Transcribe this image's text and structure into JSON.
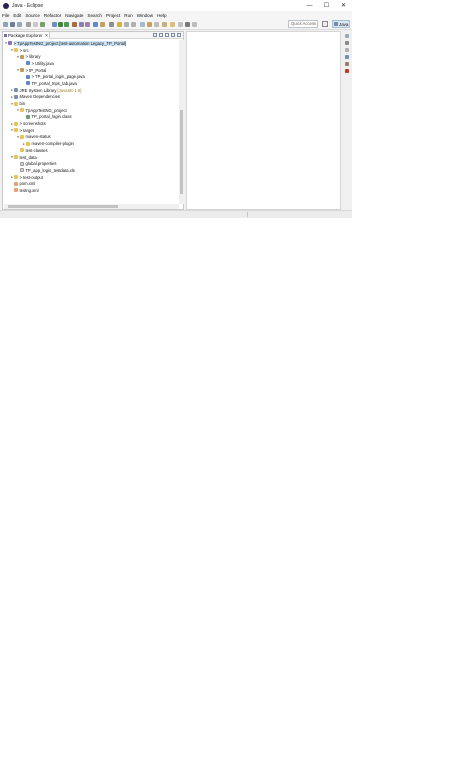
{
  "window": {
    "title": "Java - Eclipse",
    "controls": [
      "—",
      "☐",
      "✕"
    ]
  },
  "menu": [
    "File",
    "Edit",
    "Source",
    "Refactor",
    "Navigate",
    "Search",
    "Project",
    "Run",
    "Window",
    "Help"
  ],
  "toolbar": {
    "quick_access_placeholder": "Quick Access",
    "perspective_label": "Java"
  },
  "explorer": {
    "tab_label": "Package Explorer",
    "tab_close": "✕",
    "tree": [
      {
        "depth": 0,
        "expanded": true,
        "icon": "project",
        "label": "> TpAppTestNG_project [test-automation Legacy_TP_Portal]",
        "selected": true
      },
      {
        "depth": 1,
        "expanded": true,
        "icon": "folder",
        "label": "> src"
      },
      {
        "depth": 2,
        "expanded": true,
        "icon": "pkg",
        "label": "> library"
      },
      {
        "depth": 3,
        "expanded": null,
        "icon": "java",
        "label": "> Utility.java"
      },
      {
        "depth": 2,
        "expanded": true,
        "icon": "pkg",
        "label": "> tP_Portal"
      },
      {
        "depth": 3,
        "expanded": null,
        "icon": "java",
        "label": "> TP_portal_login_page.java"
      },
      {
        "depth": 3,
        "expanded": null,
        "icon": "java",
        "label": "TP_portal_trips_tab.java"
      },
      {
        "depth": 1,
        "expanded": false,
        "icon": "lib",
        "label": "JRE System Library",
        "decoration": "[JavaSE-1.8]"
      },
      {
        "depth": 1,
        "expanded": false,
        "icon": "lib",
        "label": "Maven Dependencies"
      },
      {
        "depth": 1,
        "expanded": true,
        "icon": "folder",
        "label": "bin"
      },
      {
        "depth": 2,
        "expanded": true,
        "icon": "folder",
        "label": "TpAppTestNG_project"
      },
      {
        "depth": 3,
        "expanded": null,
        "icon": "cls",
        "label": "TP_portal_login.class"
      },
      {
        "depth": 1,
        "expanded": false,
        "icon": "folder",
        "label": "> screenshots"
      },
      {
        "depth": 1,
        "expanded": true,
        "icon": "folder",
        "label": "> target"
      },
      {
        "depth": 2,
        "expanded": true,
        "icon": "folder",
        "label": "maven-status"
      },
      {
        "depth": 3,
        "expanded": false,
        "icon": "folder",
        "label": "maven-compiler-plugin"
      },
      {
        "depth": 2,
        "expanded": null,
        "icon": "folder",
        "label": "test-classes"
      },
      {
        "depth": 1,
        "expanded": true,
        "icon": "folder",
        "label": "test_data"
      },
      {
        "depth": 2,
        "expanded": null,
        "icon": "file",
        "label": "global.properties"
      },
      {
        "depth": 2,
        "expanded": null,
        "icon": "file",
        "label": "TP_app_login_testdata.xls"
      },
      {
        "depth": 1,
        "expanded": false,
        "icon": "folder",
        "label": "> test-output"
      },
      {
        "depth": 1,
        "expanded": null,
        "icon": "xml",
        "label": "pom.xml"
      },
      {
        "depth": 1,
        "expanded": null,
        "icon": "xml",
        "label": "testng.xml"
      }
    ]
  },
  "icons": {
    "app": "eclipse-icon",
    "colors": {
      "selection": "#cde3f7",
      "project": "#8a6fbf",
      "folder": "#e9c35a",
      "java": "#5b8bc7"
    }
  }
}
